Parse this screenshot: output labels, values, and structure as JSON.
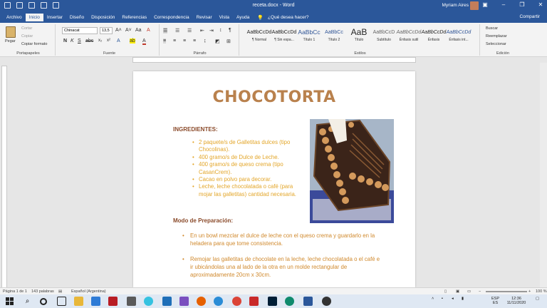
{
  "window": {
    "title": "receta.docx - Word",
    "user": "Myriam Aires"
  },
  "tabs": [
    "Archivo",
    "Inicio",
    "Insertar",
    "Diseño",
    "Disposición",
    "Referencias",
    "Correspondencia",
    "Revisar",
    "Vista",
    "Ayuda"
  ],
  "tell_me": "¿Qué desea hacer?",
  "share": "Compartir",
  "ribbon": {
    "paste": "Pegar",
    "cut": "Cortar",
    "copy": "Copiar",
    "format_painter": "Copiar formato",
    "clipboard_label": "Portapapeles",
    "font_name": "Chinacat",
    "font_size": "13,5",
    "font_label": "Fuente",
    "paragraph_label": "Párrafo",
    "styles_label": "Estilos",
    "styles": [
      {
        "preview": "AaBbCcDd",
        "name": "¶ Normal"
      },
      {
        "preview": "AaBbCcDd",
        "name": "¶ Sin espa..."
      },
      {
        "preview": "AaBbCc",
        "name": "Título 1"
      },
      {
        "preview": "AaBbCc",
        "name": "Título 2"
      },
      {
        "preview": "AaB",
        "name": "Título"
      },
      {
        "preview": "AaBbCcD",
        "name": "Subtítulo"
      },
      {
        "preview": "AaBbCcDd",
        "name": "Énfasis sutil"
      },
      {
        "preview": "AaBbCcDd",
        "name": "Énfasis"
      },
      {
        "preview": "AaBbCcDd",
        "name": "Énfasis int..."
      }
    ],
    "find": "Buscar",
    "replace": "Reemplazar",
    "select": "Seleccionar",
    "editing_label": "Edición"
  },
  "document": {
    "title": "CHOCOTORTA",
    "ingredients_heading": "INGREDIENTES:",
    "ingredients": [
      "2 paquete/s de Galletitas dulces (tipo Chocolinas).",
      "400 gramo/s de Dulce de Leche.",
      "400 gramo/s de queso crema (tipo CasanCrem).",
      "Cacao en polvo para decorar.",
      "Leche, leche chocolatada o café (para mojar las galletitas) cantidad necesaria."
    ],
    "prep_heading": "Modo de Preparación:",
    "steps": [
      "En un bowl mezclar el dulce de leche con el queso crema y guardarlo en la heladera para que tome consistencia.",
      "Remojar las galletitas de chocolate en la leche, leche chocolatada o el café e ir ubicándolas una al lado de la otra en un molde rectangular de aproximadamente 20cm x 30cm."
    ]
  },
  "status": {
    "page": "Página 1 de 1",
    "words": "143 palabras",
    "language": "Español (Argentina)",
    "zoom": "100 %"
  },
  "tray": {
    "lang": "ESP",
    "region": "ES",
    "time": "12:36",
    "date": "11/11/2020"
  },
  "colors": {
    "accent": "#2b579a",
    "title": "#b9814d",
    "heading": "#8a4a2a",
    "ingredient": "#e3a62a",
    "step": "#d0892d"
  }
}
